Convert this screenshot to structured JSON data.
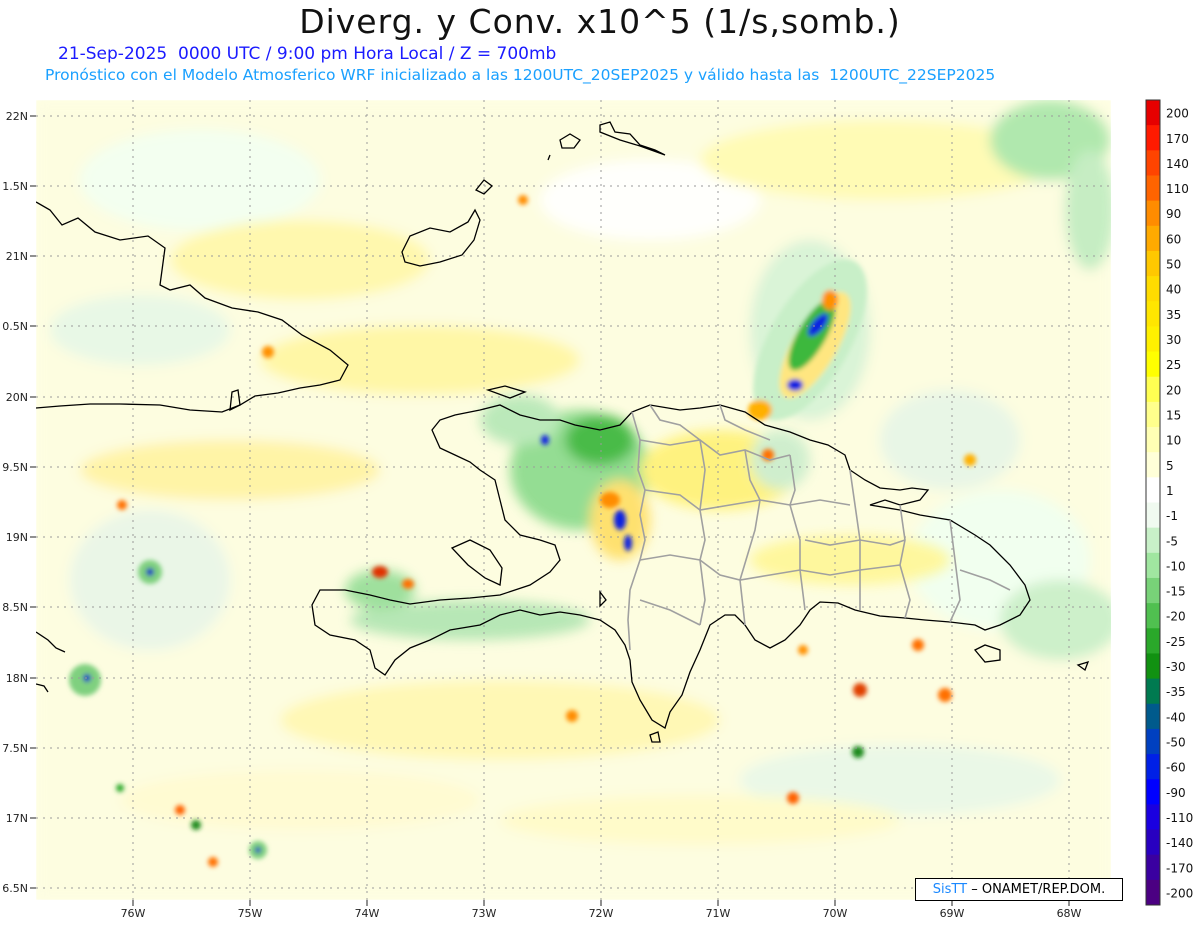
{
  "header": {
    "title": "Diverg. y Conv. x10^5 (1/s,somb.)",
    "valid_line": "21-Sep-2025  0000 UTC / 9:00 pm Hora Local / Z = 700mb",
    "model_line": "Pronóstico con el Modelo Atmosferico WRF inicializado a las 1200UTC_20SEP2025 y válido hasta las  1200UTC_22SEP2025"
  },
  "map": {
    "lat_labels": [
      "22N",
      "1.5N",
      "21N",
      "0.5N",
      "20N",
      "9.5N",
      "19N",
      "8.5N",
      "18N",
      "7.5N",
      "17N",
      "6.5N"
    ],
    "lon_labels": [
      "76W",
      "75W",
      "74W",
      "73W",
      "72W",
      "71W",
      "70W",
      "69W",
      "68W"
    ],
    "colors": {
      "coast": "#000000",
      "provinces": "#9a9a9a",
      "grid": "#9a9a9a"
    }
  },
  "colorbar": {
    "labels": [
      "200",
      "170",
      "140",
      "110",
      "90",
      "60",
      "50",
      "40",
      "35",
      "30",
      "25",
      "20",
      "15",
      "10",
      "5",
      "1",
      "-1",
      "-5",
      "-10",
      "-15",
      "-20",
      "-25",
      "-30",
      "-35",
      "-40",
      "-50",
      "-60",
      "-90",
      "-110",
      "-140",
      "-170",
      "-200"
    ],
    "colors": [
      "#e60000",
      "#ff1a00",
      "#ff4400",
      "#ff6400",
      "#ff8c00",
      "#ffaa00",
      "#ffc800",
      "#ffdc00",
      "#ffe600",
      "#fff000",
      "#ffff00",
      "#ffff52",
      "#ffff8c",
      "#ffffb4",
      "#ffffd8",
      "#ffffff",
      "#f0faf0",
      "#c8f0c8",
      "#a0e6a0",
      "#78d278",
      "#50c050",
      "#2aa82a",
      "#119111",
      "#007a50",
      "#005a8c",
      "#0040c0",
      "#0020e6",
      "#0000ff",
      "#1a00e0",
      "#2800c0",
      "#3a00a0",
      "#4b0082"
    ]
  },
  "credit": {
    "brand": "SisTT",
    "text": "– ONAMET/REP.DOM."
  }
}
